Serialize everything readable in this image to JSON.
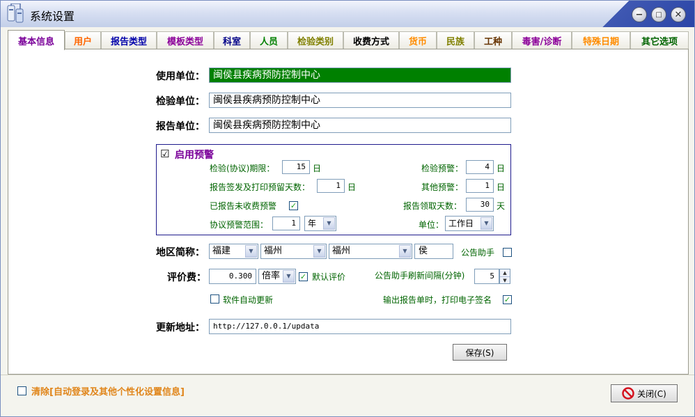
{
  "window": {
    "title": "系统设置"
  },
  "tabs": [
    {
      "label": "基本信息",
      "color": "#7a0099"
    },
    {
      "label": "用户",
      "color": "#ff6600"
    },
    {
      "label": "报告类型",
      "color": "#0000aa"
    },
    {
      "label": "模板类型",
      "color": "#8b0099"
    },
    {
      "label": "科室",
      "color": "#000088"
    },
    {
      "label": "人员",
      "color": "#008000"
    },
    {
      "label": "检验类别",
      "color": "#808000"
    },
    {
      "label": "收费方式",
      "color": "#000000"
    },
    {
      "label": "货币",
      "color": "#ff8c00"
    },
    {
      "label": "民族",
      "color": "#808000"
    },
    {
      "label": "工种",
      "color": "#663300"
    },
    {
      "label": "毒害/诊断",
      "color": "#8b0099"
    },
    {
      "label": "特殊日期",
      "color": "#ff8c00"
    },
    {
      "label": "其它选项",
      "color": "#006400"
    }
  ],
  "basic": {
    "use_unit_label": "使用单位：",
    "use_unit_value": "闽侯县疾病预防控制中心",
    "inspect_unit_label": "检验单位：",
    "inspect_unit_value": "闽侯县疾病预防控制中心",
    "report_unit_label": "报告单位：",
    "report_unit_value": "闽侯县疾病预防控制中心"
  },
  "warning": {
    "enable_label": "启用预警",
    "enable_checked": "☑",
    "period_label": "检验(协议)期限：",
    "period_value": "15",
    "period_unit": "日",
    "inspect_warn_label": "检验预警：",
    "inspect_warn_value": "4",
    "inspect_warn_unit": "日",
    "reserve_days_label": "报告签发及打印预留天数：",
    "reserve_days_value": "1",
    "reserve_days_unit": "日",
    "other_warn_label": "其他预警：",
    "other_warn_value": "1",
    "other_warn_unit": "日",
    "unpaid_label": "已报告未收费预警",
    "unpaid_checked": "✓",
    "collect_days_label": "报告领取天数：",
    "collect_days_value": "30",
    "collect_days_unit": "天",
    "range_label": "协议预警范围：",
    "range_value": "1",
    "range_unit": "年",
    "unit_label": "单位：",
    "unit_value": "工作日"
  },
  "region": {
    "label": "地区简称：",
    "province": "福建",
    "city": "福州",
    "district": "福州",
    "short": "侯",
    "helper_label": "公告助手"
  },
  "fee": {
    "label": "评价费：",
    "value": "0.300",
    "mode": "倍率",
    "default_label": "默认评价",
    "default_checked": "✓",
    "refresh_label": "公告助手刷新间隔(分钟)",
    "refresh_value": "5"
  },
  "options": {
    "auto_update_label": "软件自动更新",
    "esign_label": "输出报告单时，打印电子签名",
    "esign_checked": "✓"
  },
  "update": {
    "label": "更新地址：",
    "url": "http://127.0.0.1/updata"
  },
  "buttons": {
    "save": "保存(S)",
    "close": "关闭(C)"
  },
  "footer": {
    "clear_label": "清除[自动登录及其他个性化设置信息]"
  }
}
